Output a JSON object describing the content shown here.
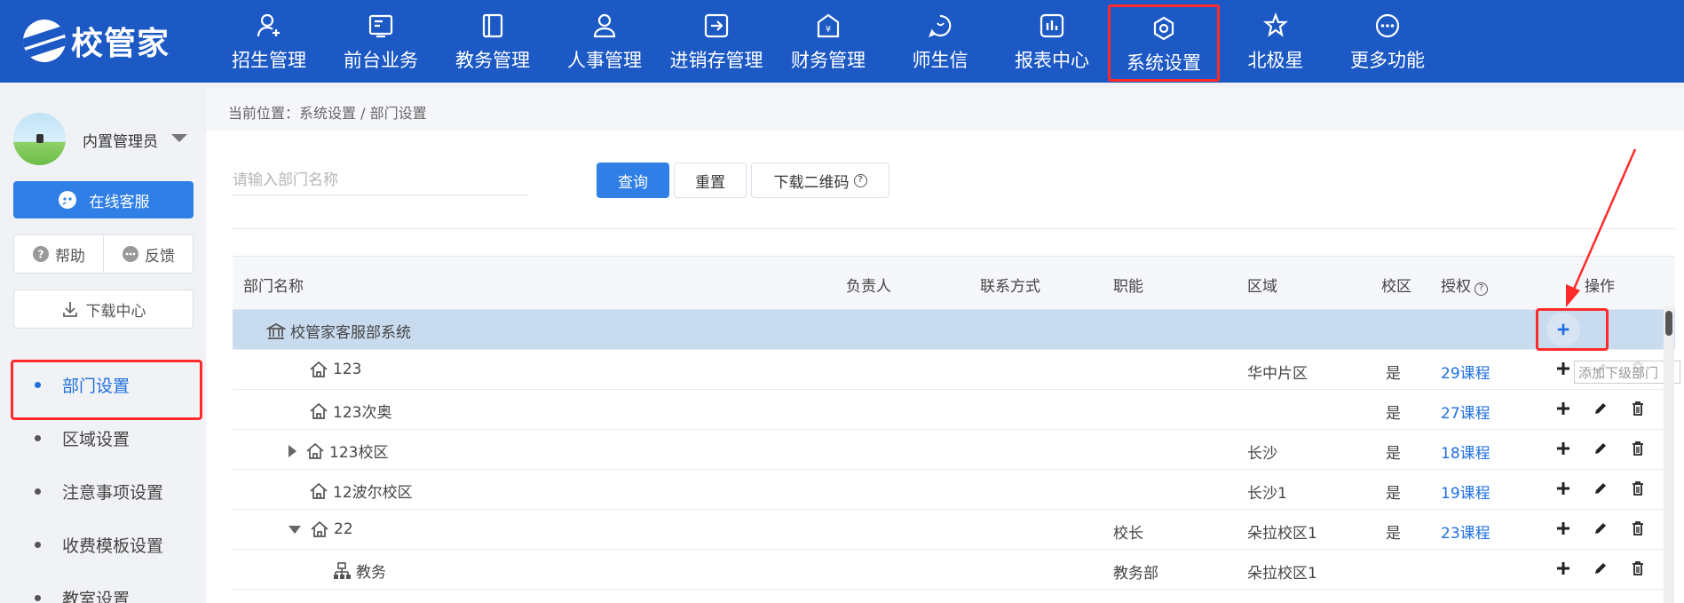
{
  "app": {
    "logo_text": "校管家",
    "logo_icon": "swoosh-logo"
  },
  "nav": {
    "items": [
      {
        "label": "招生管理",
        "icon": "user-plus-icon"
      },
      {
        "label": "前台业务",
        "icon": "screen-icon"
      },
      {
        "label": "教务管理",
        "icon": "book-icon"
      },
      {
        "label": "人事管理",
        "icon": "person-icon"
      },
      {
        "label": "进销存管理",
        "icon": "transfer-icon"
      },
      {
        "label": "财务管理",
        "icon": "money-bag-icon"
      },
      {
        "label": "师生信",
        "icon": "chat-bubble-icon"
      },
      {
        "label": "报表中心",
        "icon": "report-icon"
      },
      {
        "label": "系统设置",
        "icon": "gear-icon",
        "highlighted": true
      },
      {
        "label": "北极星",
        "icon": "star-icon"
      },
      {
        "label": "更多功能",
        "icon": "more-icon"
      }
    ]
  },
  "user": {
    "name": "内置管理员"
  },
  "sidebar": {
    "service_label": "在线客服",
    "help_label": "帮助",
    "feedback_label": "反馈",
    "download_label": "下载中心",
    "menu": [
      {
        "label": "部门设置",
        "active": true
      },
      {
        "label": "区域设置"
      },
      {
        "label": "注意事项设置"
      },
      {
        "label": "收费模板设置"
      },
      {
        "label": "教室设置"
      }
    ]
  },
  "breadcrumb": "当前位置：系统设置 / 部门设置",
  "search": {
    "placeholder": "请输入部门名称",
    "query_label": "查询",
    "reset_label": "重置",
    "qr_label": "下载二维码"
  },
  "table": {
    "headers": {
      "name": "部门名称",
      "owner": "负责人",
      "contact": "联系方式",
      "function": "职能",
      "region": "区域",
      "campus": "校区",
      "auth": "授权",
      "actions": "操作"
    },
    "rows": [
      {
        "name": "校管家客服部系统",
        "icon": "bank-icon",
        "level": 0,
        "region": "",
        "campus": "",
        "auth": "",
        "function": "",
        "selected": true
      },
      {
        "name": "123",
        "icon": "home-icon",
        "level": 1,
        "region": "华中片区",
        "campus": "是",
        "auth": "29课程",
        "function": ""
      },
      {
        "name": "123次奥",
        "icon": "home-icon",
        "level": 1,
        "region": "",
        "campus": "是",
        "auth": "27课程",
        "function": ""
      },
      {
        "name": "123校区",
        "icon": "home-icon",
        "level": 1,
        "expand": "collapsed",
        "region": "长沙",
        "campus": "是",
        "auth": "18课程",
        "function": ""
      },
      {
        "name": "12波尔校区",
        "icon": "home-icon",
        "level": 1,
        "region": "长沙1",
        "campus": "是",
        "auth": "19课程",
        "function": ""
      },
      {
        "name": "22",
        "icon": "home-icon",
        "level": 1,
        "expand": "expanded",
        "region": "朵拉校区1",
        "campus": "是",
        "auth": "23课程",
        "function": "校长"
      },
      {
        "name": "教务",
        "icon": "org-chart-icon",
        "level": 2,
        "region": "朵拉校区1",
        "campus": "",
        "auth": "",
        "function": "教务部"
      }
    ]
  },
  "tooltip": "添加下级部门",
  "colors": {
    "brand": "#1c59c4",
    "accent": "#2f7fe6",
    "highlight": "#ff2b2b",
    "selected_row": "#c9dbef"
  }
}
